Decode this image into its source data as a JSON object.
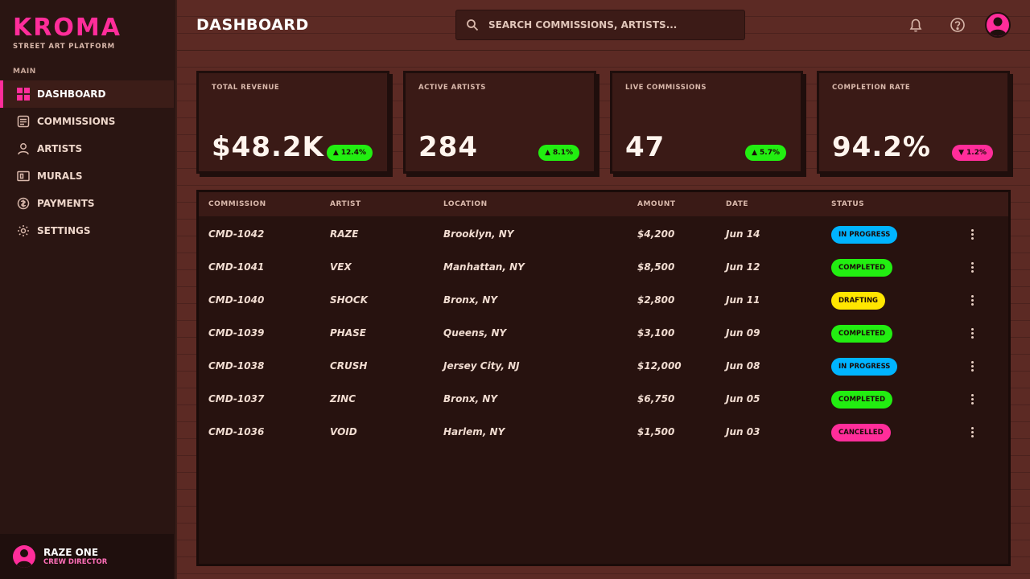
{
  "brand": {
    "name": "KROMA",
    "tagline": "STREET ART PLATFORM",
    "accent": "#ff2d9a"
  },
  "sidebar": {
    "section": "MAIN",
    "items": [
      {
        "label": "DASHBOARD",
        "icon": "grid-icon",
        "active": true
      },
      {
        "label": "COMMISSIONS",
        "icon": "document-icon",
        "active": false
      },
      {
        "label": "ARTISTS",
        "icon": "user-icon",
        "active": false
      },
      {
        "label": "MURALS",
        "icon": "image-icon",
        "active": false
      },
      {
        "label": "PAYMENTS",
        "icon": "coin-icon",
        "active": false
      },
      {
        "label": "SETTINGS",
        "icon": "gear-icon",
        "active": false
      }
    ],
    "user": {
      "name": "RAZE ONE",
      "role": "CREW DIRECTOR"
    }
  },
  "header": {
    "title": "DASHBOARD",
    "search_placeholder": "SEARCH COMMISSIONS, ARTISTS..."
  },
  "stats": [
    {
      "label": "TOTAL REVENUE",
      "value": "$48.2K",
      "change": "12.4%",
      "direction": "up",
      "color": "#22ee11"
    },
    {
      "label": "ACTIVE ARTISTS",
      "value": "284",
      "change": "8.1%",
      "direction": "up",
      "color": "#22ee11"
    },
    {
      "label": "LIVE COMMISSIONS",
      "value": "47",
      "change": "5.7%",
      "direction": "up",
      "color": "#22ee11"
    },
    {
      "label": "COMPLETION RATE",
      "value": "94.2%",
      "change": "1.2%",
      "direction": "down",
      "color": "#ff2d9a"
    }
  ],
  "table": {
    "columns": [
      "COMMISSION",
      "ARTIST",
      "LOCATION",
      "AMOUNT",
      "DATE",
      "STATUS"
    ],
    "rows": [
      {
        "id": "CMD-1042",
        "artist": "RAZE",
        "location": "Brooklyn, NY",
        "amount": "$4,200",
        "date": "Jun 14",
        "status": "IN PROGRESS",
        "status_color": "#00b4ff"
      },
      {
        "id": "CMD-1041",
        "artist": "VEX",
        "location": "Manhattan, NY",
        "amount": "$8,500",
        "date": "Jun 12",
        "status": "COMPLETED",
        "status_color": "#22ee11"
      },
      {
        "id": "CMD-1040",
        "artist": "SHOCK",
        "location": "Bronx, NY",
        "amount": "$2,800",
        "date": "Jun 11",
        "status": "DRAFTING",
        "status_color": "#ffe600"
      },
      {
        "id": "CMD-1039",
        "artist": "PHASE",
        "location": "Queens, NY",
        "amount": "$3,100",
        "date": "Jun 09",
        "status": "COMPLETED",
        "status_color": "#22ee11"
      },
      {
        "id": "CMD-1038",
        "artist": "CRUSH",
        "location": "Jersey City, NJ",
        "amount": "$12,000",
        "date": "Jun 08",
        "status": "IN PROGRESS",
        "status_color": "#00b4ff"
      },
      {
        "id": "CMD-1037",
        "artist": "ZINC",
        "location": "Bronx, NY",
        "amount": "$6,750",
        "date": "Jun 05",
        "status": "COMPLETED",
        "status_color": "#22ee11"
      },
      {
        "id": "CMD-1036",
        "artist": "VOID",
        "location": "Harlem, NY",
        "amount": "$1,500",
        "date": "Jun 03",
        "status": "CANCELLED",
        "status_color": "#ff2d9a"
      }
    ]
  }
}
